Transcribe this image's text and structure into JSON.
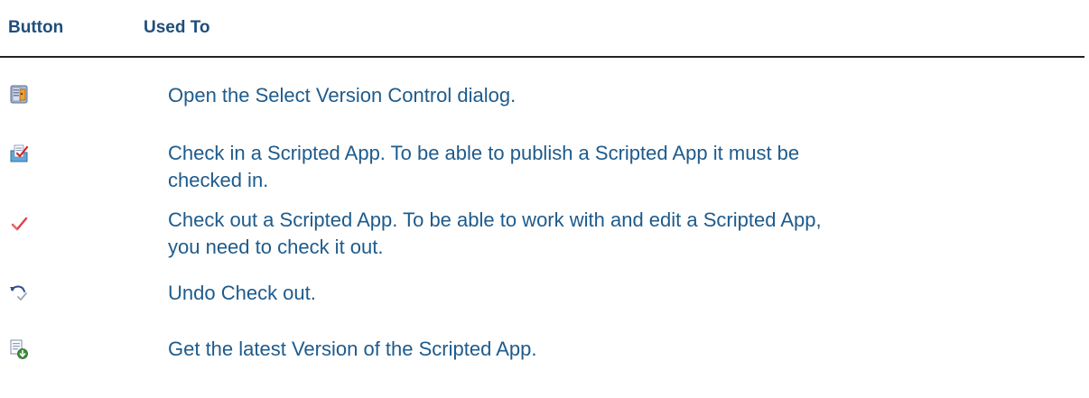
{
  "table": {
    "header": {
      "button": "Button",
      "used_to": "Used To"
    },
    "rows": [
      {
        "icon": "version-control-icon",
        "text": "Open the Select Version Control dialog."
      },
      {
        "icon": "check-in-icon",
        "text": "Check in a Scripted App.  To be able to publish a Scripted App it must be checked in."
      },
      {
        "icon": "check-out-icon",
        "text": "Check out a Scripted App.  To be able to work with and edit a Scripted App, you need to check it out."
      },
      {
        "icon": "undo-check-out-icon",
        "text": "Undo Check out."
      },
      {
        "icon": "get-latest-version-icon",
        "text": "Get the latest Version of the Scripted App."
      }
    ]
  },
  "colors": {
    "header_text": "#1f4e79",
    "body_text": "#1e5b8c",
    "rule": "#222222"
  }
}
